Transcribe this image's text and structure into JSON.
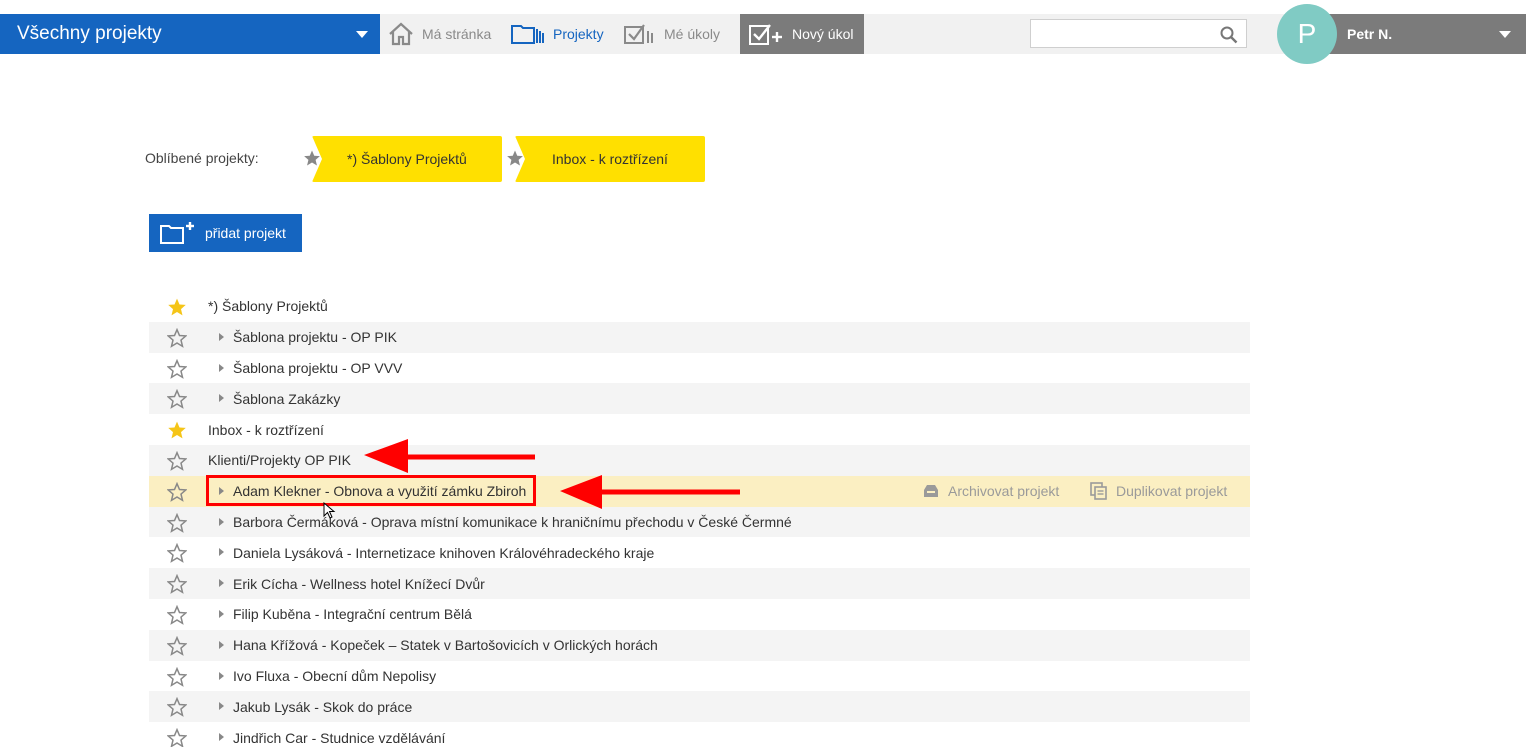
{
  "header": {
    "project_selector": "Všechny projekty",
    "nav": [
      {
        "label": "Má stránka",
        "icon": "home-icon",
        "active": false
      },
      {
        "label": "Projekty",
        "icon": "projects-icon",
        "active": true
      },
      {
        "label": "Mé úkoly",
        "icon": "tasks-icon",
        "active": false
      }
    ],
    "new_task_label": "Nový úkol",
    "search": {
      "placeholder": "",
      "value": ""
    },
    "user": {
      "initial": "P",
      "name": "Petr N."
    }
  },
  "favorites": {
    "label": "Oblíbené projekty:",
    "items": [
      "*) Šablony Projektů",
      "Inbox - k roztřízení"
    ]
  },
  "add_project_label": "přidat projekt",
  "projects": [
    {
      "name": "*) Šablony Projektů",
      "favorite": true,
      "child": false
    },
    {
      "name": "Šablona projektu - OP PIK",
      "favorite": false,
      "child": true
    },
    {
      "name": "Šablona projektu - OP VVV",
      "favorite": false,
      "child": true
    },
    {
      "name": "Šablona Zakázky",
      "favorite": false,
      "child": true
    },
    {
      "name": "Inbox - k roztřízení",
      "favorite": true,
      "child": false
    },
    {
      "name": "Klienti/Projekty OP PIK",
      "favorite": false,
      "child": false
    },
    {
      "name": "Adam Klekner - Obnova a využití zámku Zbiroh",
      "favorite": false,
      "child": true
    },
    {
      "name": "Barbora Čermáková - Oprava místní komunikace k hraničnímu přechodu v České Čermné",
      "favorite": false,
      "child": true
    },
    {
      "name": "Daniela Lysáková - Internetizace knihoven Královéhradeckého kraje",
      "favorite": false,
      "child": true
    },
    {
      "name": "Erik Cícha - Wellness hotel Knížecí Dvůr",
      "favorite": false,
      "child": true
    },
    {
      "name": "Filip Kuběna - Integrační centrum Bělá",
      "favorite": false,
      "child": true
    },
    {
      "name": "Hana Křížová - Kopeček – Statek v Bartošovicích v Orlických horách",
      "favorite": false,
      "child": true
    },
    {
      "name": "Ivo Fluxa - Obecní dům Nepolisy",
      "favorite": false,
      "child": true
    },
    {
      "name": "Jakub Lysák - Skok do práce",
      "favorite": false,
      "child": true
    },
    {
      "name": "Jindřich Car - Studnice vzdělávání",
      "favorite": false,
      "child": true
    }
  ],
  "row_actions": {
    "archive": "Archivovat projekt",
    "duplicate": "Duplikovat projekt"
  },
  "colors": {
    "brand_blue": "#1565c0",
    "favorite_yellow": "#ffe000",
    "star_gold": "#f5c518",
    "highlight_row": "#fbefc2",
    "annotation_red": "#ff0000",
    "avatar": "#80cbc4"
  }
}
